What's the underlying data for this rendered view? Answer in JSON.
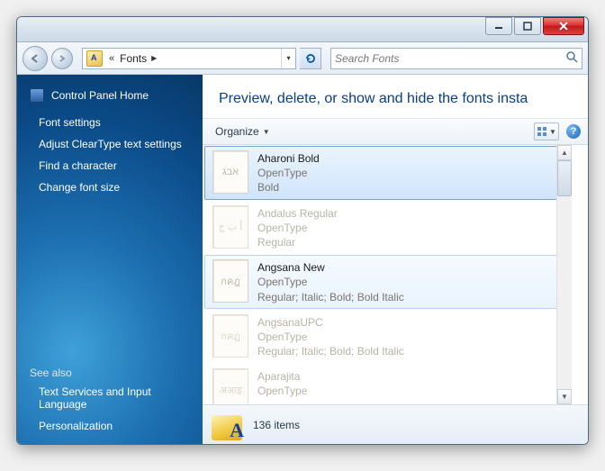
{
  "breadcrumb": {
    "location": "Fonts"
  },
  "search": {
    "placeholder": "Search Fonts"
  },
  "sidebar": {
    "home": "Control Panel Home",
    "links": [
      "Font settings",
      "Adjust ClearType text settings",
      "Find a character",
      "Change font size"
    ],
    "see_also_heading": "See also",
    "see_also": [
      "Text Services and Input Language",
      "Personalization"
    ]
  },
  "main": {
    "heading": "Preview, delete, or show and hide the fonts insta",
    "organize_label": "Organize"
  },
  "fonts": [
    {
      "name": "Aharoni Bold",
      "type": "OpenType",
      "style": "Bold",
      "thumb": "אבג",
      "state": "selected",
      "family": false
    },
    {
      "name": "Andalus Regular",
      "type": "OpenType",
      "style": "Regular",
      "thumb": "أ ب ج",
      "state": "dim",
      "family": false
    },
    {
      "name": "Angsana New",
      "type": "OpenType",
      "style": "Regular; Italic; Bold; Bold Italic",
      "thumb": "กคฎ",
      "state": "hover",
      "family": true
    },
    {
      "name": "AngsanaUPC",
      "type": "OpenType",
      "style": "Regular; Italic; Bold; Bold Italic",
      "thumb": "กคฎ",
      "state": "dim",
      "family": true
    },
    {
      "name": "Aparajita",
      "type": "OpenType",
      "style": "",
      "thumb": "अआइ",
      "state": "dim",
      "family": true
    }
  ],
  "status": {
    "count": "136 items"
  }
}
